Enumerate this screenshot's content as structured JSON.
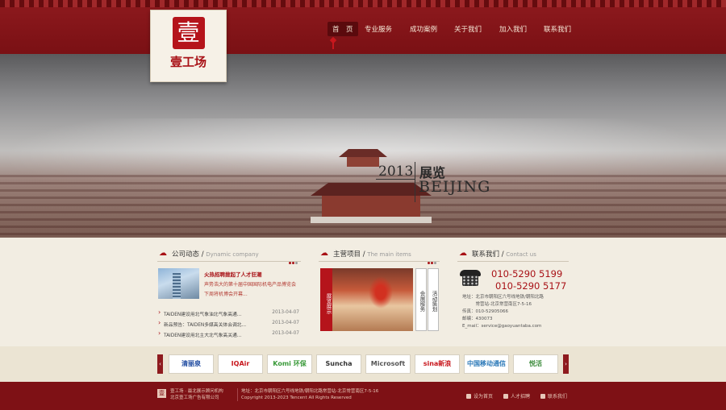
{
  "logo": {
    "seal": "壹",
    "text": "壹工场"
  },
  "nav": [
    {
      "label": "首　页",
      "active": true
    },
    {
      "label": "专业服务"
    },
    {
      "label": "成功案例"
    },
    {
      "label": "关于我们"
    },
    {
      "label": "加入我们"
    },
    {
      "label": "联系我们"
    }
  ],
  "banner": {
    "year": "2013",
    "title": "展览",
    "city": "BEIJING"
  },
  "news": {
    "title": "公司动态",
    "title_en": "Dynamic company",
    "feature_title": "火热招聘掀起了人才狂潮",
    "feature_desc": "声势浩大的第十届中国国际机电产品博览会下周将机博会开幕...",
    "items": [
      {
        "text": "TAIDEN建设用北气象油北气象高通...",
        "date": "2013-04-07"
      },
      {
        "text": "新品预告：TAIDEN多媒高关体会调北...",
        "date": "2013-04-07"
      },
      {
        "text": "TAIDEN建设用北主大北气象高关通...",
        "date": "2013-04-07"
      }
    ]
  },
  "main_items": {
    "title": "主营项目",
    "title_en": "The main items",
    "red_label": "展览展示",
    "tab1": "会展服务",
    "tab2": "活动策划"
  },
  "contact": {
    "title": "联系我们",
    "title_en": "Contact us",
    "tel1": "010-5290 5199",
    "tel2": "010-5290 5177",
    "address1": "地址：北京市朝阳区六号线地铁/朝阳北路",
    "address2": "　　　常营站-北京常营南区7-5-16",
    "fax": "传真：010-52905066",
    "zip": "邮编：430073",
    "email": "E_mail：service@gaoyuantaba.com"
  },
  "partners": [
    {
      "name": "清丽泉",
      "color": "#1e4aa0"
    },
    {
      "name": "IQAir",
      "color": "#c8171d"
    },
    {
      "name": "Komi 环保",
      "color": "#3a9a3a"
    },
    {
      "name": "Suncha",
      "color": "#333333"
    },
    {
      "name": "Microsoft",
      "color": "#555555"
    },
    {
      "name": "sina新浪",
      "color": "#c8171d"
    },
    {
      "name": "中国移动通信",
      "color": "#2a78b8"
    },
    {
      "name": "悦活",
      "color": "#3a8a3a"
    }
  ],
  "footer": {
    "brand1": "壹工场 · 最北展示顾问机构",
    "brand2": "北京壹工场广告有限公司",
    "addr": "地址：北京市朝阳区六号线地铁/朝阳北路常营站-北京常营南区7-5-16",
    "copy": "Copyright 2013-2023 Tencent All Rights Reserved",
    "links": [
      "设为首页",
      "人才招聘",
      "联系我们"
    ]
  },
  "colors": {
    "brand_red": "#8e1a1e",
    "accent_red": "#a81116",
    "cream": "#f2ede2"
  }
}
